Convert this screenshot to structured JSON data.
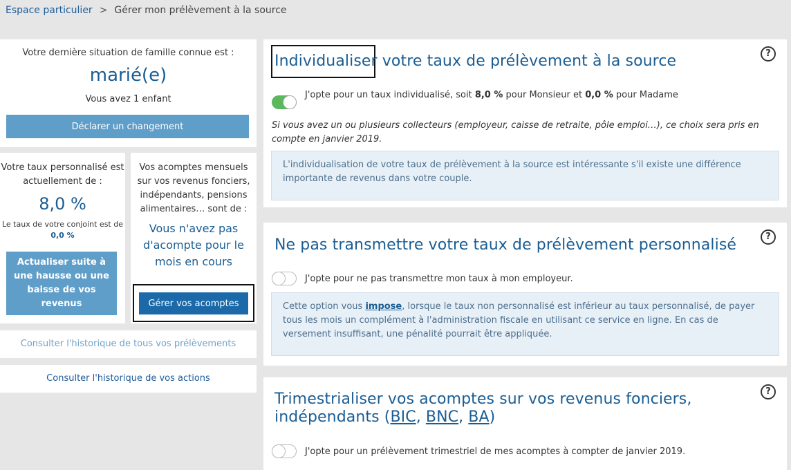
{
  "breadcrumb": {
    "home": "Espace particulier",
    "separator": ">",
    "current": "Gérer mon prélèvement à la source"
  },
  "family": {
    "label": "Votre dernière situation de famille connue est :",
    "status": "marié(e)",
    "children": "Vous avez 1 enfant",
    "button": "Déclarer un changement"
  },
  "rate": {
    "label": "Votre taux personnalisé est actuellement de :",
    "value": "8,0 %",
    "spouse_prefix": "Le taux de votre conjoint est de",
    "spouse_value": "0,0 %",
    "button": "Actualiser suite à une hausse ou une baisse de vos revenus"
  },
  "acompte": {
    "label": "Vos acomptes mensuels sur vos revenus fonciers, indépendants, pensions alimentaires… sont de :",
    "message": "Vous n'avez pas d'acompte pour le mois en cours",
    "button": "Gérer vos acomptes"
  },
  "links": {
    "history_all": "Consulter l'historique de tous vos prélèvements",
    "history_actions": "Consulter l'historique de vos actions"
  },
  "panel1": {
    "title_part1": "Individualiser",
    "title_part2": " votre taux de prélèvement à la source",
    "option_prefix": "J'opte pour un taux individualisé, soit ",
    "rate_mr": "8,0 %",
    "mid": " pour Monsieur  et ",
    "rate_mme": "0,0 %",
    "suffix": " pour Madame",
    "note": "Si vous avez un ou plusieurs collecteurs (employeur, caisse de retraite, pôle emploi…), ce choix sera pris en compte en janvier 2019.",
    "info": "L'individualisation de votre taux de prélèvement à la source est intéressante s'il existe une différence importante de revenus dans votre couple.",
    "toggle_on": true
  },
  "panel2": {
    "title": "Ne pas transmettre votre taux de prélèvement personnalisé",
    "option": "J'opte pour ne pas transmettre mon taux à mon employeur.",
    "info_prefix": "Cette option vous ",
    "info_strong": "impose",
    "info_suffix": ", lorsque le taux non personnalisé est inférieur au taux personnalisé, de payer tous les mois un complément à l'administration fiscale en utilisant ce service en ligne. En cas de versement insuffisant, une pénalité pourrait être appliquée.",
    "toggle_on": false
  },
  "panel3": {
    "title_line1": "Trimestrialiser vos acomptes sur vos revenus fonciers,",
    "title_line2_prefix": "indépendants (",
    "link_bic": "BIC",
    "link_bnc": "BNC",
    "link_ba": "BA",
    "sep": ", ",
    "close": ")",
    "option": "J'opte pour un prélèvement trimestriel de mes acomptes à compter de janvier 2019.",
    "toggle_on": false
  },
  "help_symbol": "?"
}
